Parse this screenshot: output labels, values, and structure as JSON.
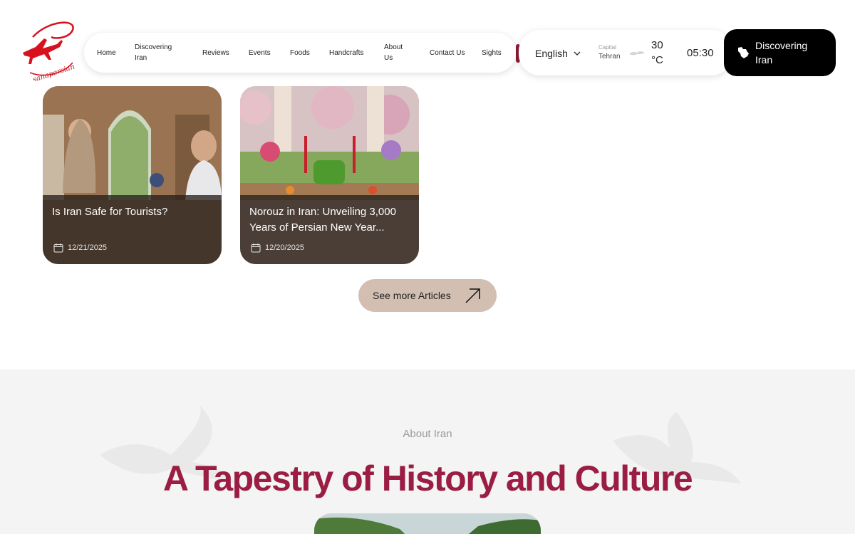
{
  "brand": {
    "logo_text": "sanapersian",
    "accent": "#d8111f"
  },
  "nav": {
    "items": [
      {
        "label": "Home"
      },
      {
        "label": "Discovering Iran"
      },
      {
        "label": "Reviews"
      },
      {
        "label": "Events"
      },
      {
        "label": "Foods"
      },
      {
        "label": "Handcrafts"
      },
      {
        "label": "About Us"
      },
      {
        "label": "Contact Us"
      },
      {
        "label": "Sights"
      }
    ]
  },
  "info": {
    "language": "English",
    "capital_label": "Capital",
    "capital_city": "Tehran",
    "weather_icon": "cloud-icon",
    "temperature": "30 °C",
    "time": "05:30"
  },
  "cta": {
    "label": "Discovering Iran",
    "icon": "iran-map-icon"
  },
  "articles": [
    {
      "title": "Is Iran Safe for Tourists?",
      "date": "12/21/2025"
    },
    {
      "title": "Norouz in Iran: Unveiling 3,000 Years of Persian New Year...",
      "date": "12/20/2025"
    }
  ],
  "more_articles": {
    "label": "See more Articles"
  },
  "about": {
    "kicker": "About Iran",
    "headline": "A Tapestry of History and Culture"
  },
  "colors": {
    "headline": "#9b1d44",
    "more_button": "#d2bfb2",
    "cta_bg": "#000000"
  }
}
